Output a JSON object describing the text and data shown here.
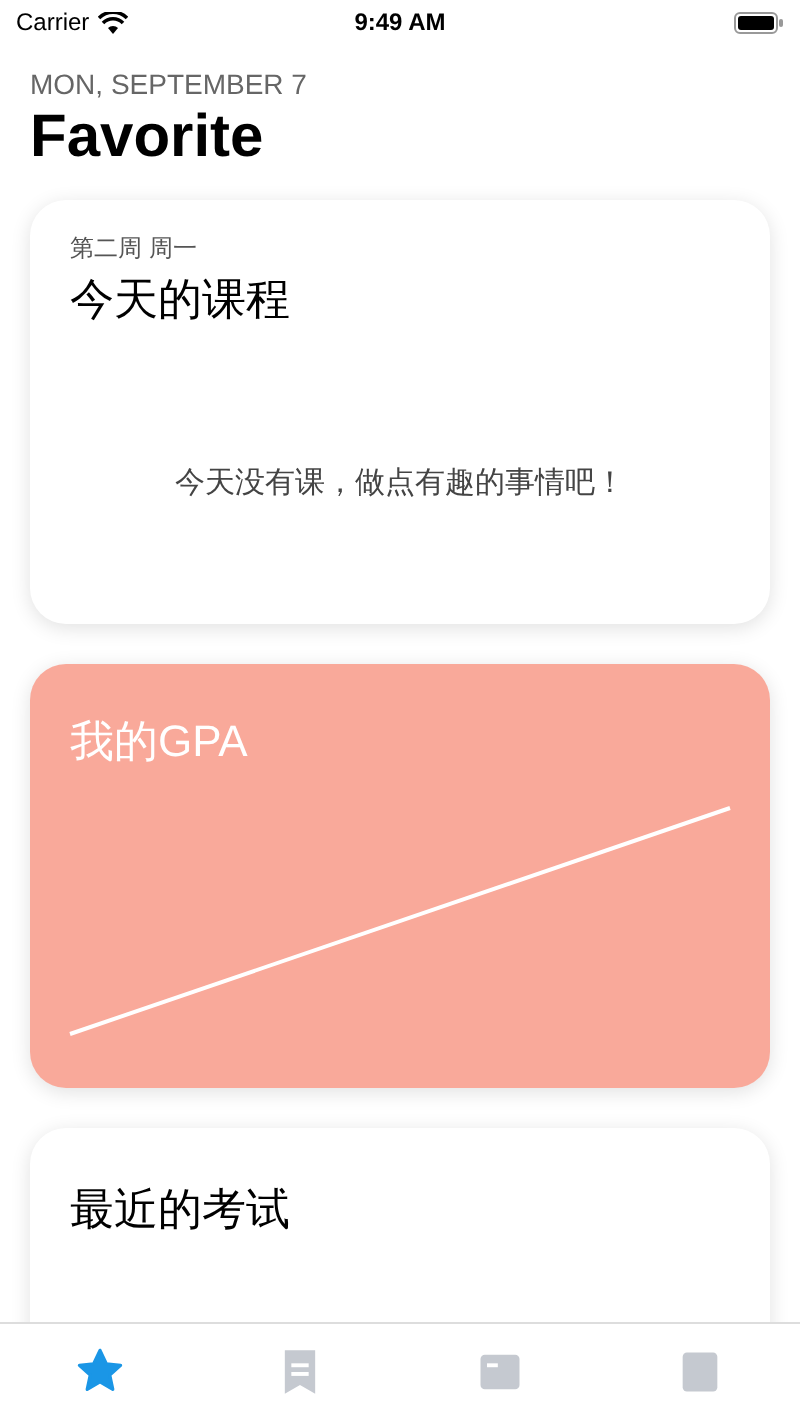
{
  "status_bar": {
    "carrier": "Carrier",
    "time": "9:49 AM"
  },
  "header": {
    "date": "MON, SEPTEMBER 7",
    "title": "Favorite"
  },
  "cards": [
    {
      "kind": "schedule",
      "subtitle": "第二周 周一",
      "title": "今天的课程",
      "message": "今天没有课，做点有趣的事情吧！"
    },
    {
      "kind": "gpa",
      "title": "我的GPA"
    },
    {
      "kind": "exams",
      "title": "最近的考试"
    }
  ],
  "tabs": [
    {
      "selected": true
    },
    {
      "selected": false
    },
    {
      "selected": false
    },
    {
      "selected": false
    }
  ]
}
